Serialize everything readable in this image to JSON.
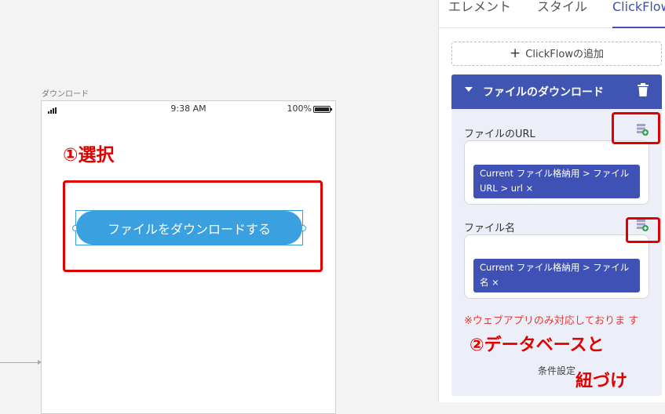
{
  "canvas": {
    "screen_label": "ダウンロード",
    "status_bar": {
      "time": "9:38 AM",
      "battery": "100%"
    },
    "download_button_label": "ファイルをダウンロードする"
  },
  "panel": {
    "tabs": [
      {
        "label": "エレメント"
      },
      {
        "label": "スタイル"
      },
      {
        "label": "ClickFlow"
      }
    ],
    "add_clickflow_label": "ClickFlowの追加",
    "card": {
      "title": "ファイルのダウンロード",
      "fields": [
        {
          "label": "ファイルのURL",
          "chip_line1": "Current ファイル格納用 > ファイル",
          "chip_line2": "URL > url ×"
        },
        {
          "label": "ファイル名",
          "chip_line1": "Current ファイル格納用 > ファイル",
          "chip_line2": "名 ×"
        }
      ],
      "note": "※ウェブアプリのみ対応しておりま す",
      "condition_label": "条件設定"
    }
  },
  "annotations": {
    "step1": "①選択",
    "step2": "②データベースと",
    "step3": "紐づけ"
  },
  "colors": {
    "accent": "#3f51b5",
    "button": "#3aa0e0",
    "annotation_red": "#e00000",
    "note_red": "#e53935"
  }
}
